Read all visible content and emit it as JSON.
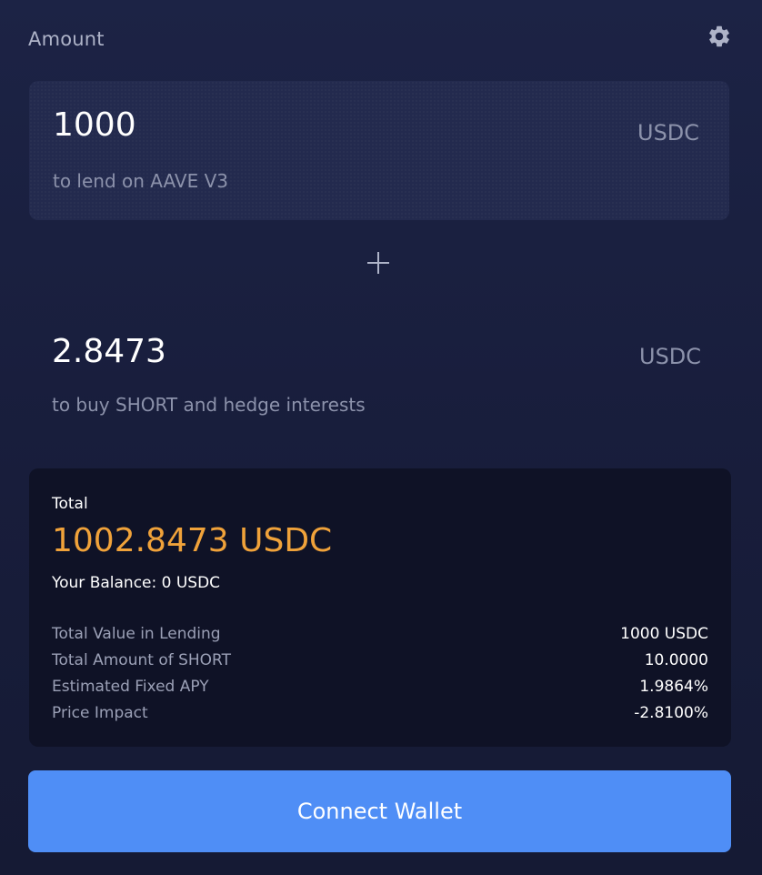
{
  "header": {
    "amount_label": "Amount",
    "settings_icon": "gear-icon"
  },
  "lend": {
    "amount_value": "1000",
    "currency": "USDC",
    "subtext": "to lend on AAVE V3"
  },
  "plus_icon": "plus-icon",
  "hedge": {
    "amount_value": "2.8473",
    "currency": "USDC",
    "subtext": "to buy SHORT and hedge interests"
  },
  "summary": {
    "total_label": "Total",
    "total_value": "1002.8473 USDC",
    "balance_text": "Your Balance: 0 USDC",
    "rows": [
      {
        "label": "Total Value in Lending",
        "value": "1000 USDC"
      },
      {
        "label": "Total Amount of SHORT",
        "value": "10.0000"
      },
      {
        "label": "Estimated Fixed APY",
        "value": "1.9864%"
      },
      {
        "label": "Price Impact",
        "value": "-2.8100%"
      }
    ]
  },
  "connect_button_label": "Connect Wallet",
  "colors": {
    "background": "#1c2345",
    "card": "#0f1226",
    "accent_total": "#f0a23a",
    "button": "#4f8ef6"
  }
}
